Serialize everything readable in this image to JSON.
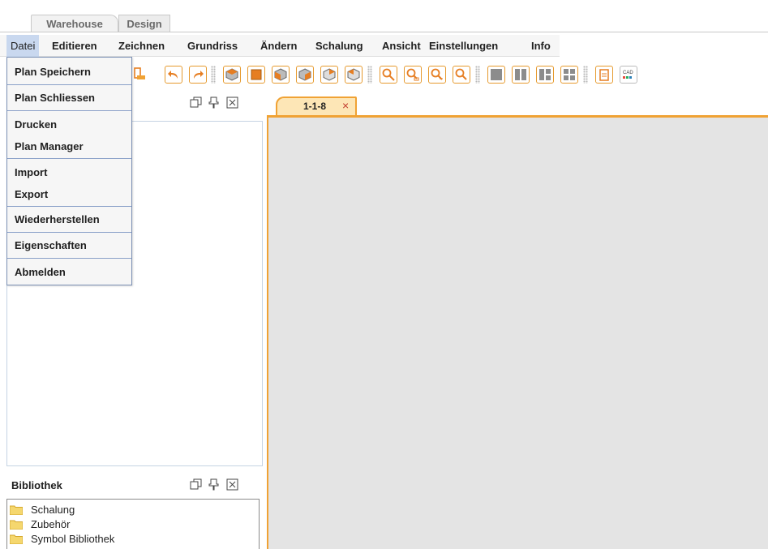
{
  "top_tabs": [
    {
      "label": "Warehouse"
    },
    {
      "label": "Design"
    }
  ],
  "menubar": {
    "items": [
      {
        "label": "Datei",
        "active": true
      },
      {
        "label": "Editieren"
      },
      {
        "label": "Zeichnen"
      },
      {
        "label": "Grundriss"
      },
      {
        "label": "Ändern"
      },
      {
        "label": "Schalung"
      },
      {
        "label": "Ansicht"
      },
      {
        "label": "Einstellungen"
      },
      {
        "label": "Info"
      }
    ]
  },
  "file_menu": {
    "items": [
      {
        "label": "Plan Speichern"
      },
      {
        "label": "Plan Schliessen"
      },
      {
        "label": "Drucken"
      },
      {
        "label": "Plan Manager"
      },
      {
        "label": "Import"
      },
      {
        "label": "Export"
      },
      {
        "label": "Wiederherstellen"
      },
      {
        "label": "Eigenschaften"
      },
      {
        "label": "Abmelden"
      }
    ]
  },
  "toolbar": {
    "buttons": [
      {
        "icon": "save-icon"
      },
      {
        "icon": "undo-icon"
      },
      {
        "icon": "redo-icon"
      },
      {
        "icon": "view-3d-iso-icon"
      },
      {
        "icon": "view-front-icon"
      },
      {
        "icon": "view-3d-left-icon"
      },
      {
        "icon": "view-3d-right-icon"
      },
      {
        "icon": "view-3d-back-left-icon"
      },
      {
        "icon": "view-3d-back-right-icon"
      },
      {
        "icon": "zoom-icon"
      },
      {
        "icon": "zoom-window-icon"
      },
      {
        "icon": "zoom-in-icon"
      },
      {
        "icon": "zoom-out-icon"
      },
      {
        "icon": "layout-single-icon"
      },
      {
        "icon": "layout-split-vertical-icon"
      },
      {
        "icon": "layout-three-icon"
      },
      {
        "icon": "layout-quad-icon"
      },
      {
        "icon": "clipboard-icon"
      },
      {
        "icon": "cad-icon"
      }
    ],
    "cad_label": "CAD"
  },
  "panels": {
    "library": {
      "title": "Bibliothek",
      "items": [
        {
          "label": "Schalung",
          "icon": "folder-icon"
        },
        {
          "label": "Zubehör",
          "icon": "folder-icon"
        },
        {
          "label": "Symbol Bibliothek",
          "icon": "folder-icon"
        }
      ]
    }
  },
  "document": {
    "tab_label": "1-1-8",
    "tab_close": "×"
  },
  "colors": {
    "accent_orange": "#f0a234",
    "tab_orange_bg": "#fde6b6",
    "menu_highlight": "#c9d8ef",
    "canvas_bg": "#e4e4e4",
    "folder_yellow": "#f5d76e"
  }
}
